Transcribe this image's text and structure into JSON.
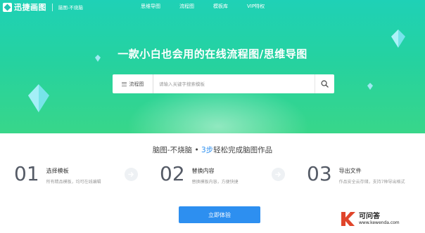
{
  "header": {
    "logo_text": "迅捷画图",
    "slogan": "脑图-不烧脑",
    "nav": [
      {
        "label": "思维导图"
      },
      {
        "label": "流程图"
      },
      {
        "label": "模板库"
      },
      {
        "label": "VIP特权"
      }
    ]
  },
  "hero": {
    "headline": "一款小白也会用的在线流程图/思维导图",
    "search": {
      "type_label": "流程图",
      "placeholder": "请输入关键字搜索模板"
    }
  },
  "steps_section": {
    "tagline_prefix": "脑图-不烧脑 • ",
    "tagline_number": "3步",
    "tagline_suffix": "轻松完成脑图作品",
    "steps": [
      {
        "number": "01",
        "title": "选择模板",
        "desc": "所有精品模板，均可在线编辑"
      },
      {
        "number": "02",
        "title": "替换内容",
        "desc": "替换模板内容，方便快捷"
      },
      {
        "number": "03",
        "title": "导出文件",
        "desc": "作品安全云存储，支持7种导出格式"
      }
    ],
    "cta_label": "立即体验"
  },
  "watermark": {
    "title": "可问答",
    "subtitle": "www.kewenda.com"
  },
  "colors": {
    "hero_top": "#1fd1b6",
    "hero_bottom": "#38d68a",
    "accent_blue": "#2d8ff0",
    "watermark_k": "#e0452b"
  }
}
